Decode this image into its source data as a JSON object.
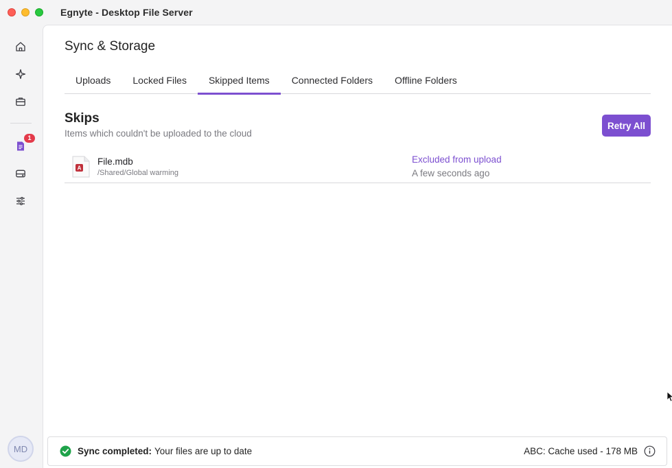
{
  "window": {
    "title": "Egnyte - Desktop File Server"
  },
  "sidebar": {
    "items": [
      {
        "name": "home",
        "icon": "home-icon"
      },
      {
        "name": "sparkle",
        "icon": "sparkle-icon"
      },
      {
        "name": "briefcase",
        "icon": "briefcase-icon"
      },
      {
        "name": "document",
        "icon": "document-icon",
        "badge": "1"
      },
      {
        "name": "drive",
        "icon": "drive-icon"
      },
      {
        "name": "settings",
        "icon": "sliders-icon"
      }
    ],
    "avatar_initials": "MD"
  },
  "page": {
    "title": "Sync & Storage",
    "tabs": [
      {
        "label": "Uploads"
      },
      {
        "label": "Locked Files"
      },
      {
        "label": "Skipped Items"
      },
      {
        "label": "Connected Folders"
      },
      {
        "label": "Offline Folders"
      }
    ],
    "active_tab": "Skipped Items"
  },
  "skips": {
    "title": "Skips",
    "subtitle": "Items which couldn't be uploaded to the cloud",
    "retry_label": "Retry All",
    "items": [
      {
        "name": "File.mdb",
        "path": "/Shared/Global warming",
        "status": "Excluded from upload",
        "time": "A few seconds ago"
      }
    ]
  },
  "statusbar": {
    "sync_label": "Sync completed:",
    "sync_text": "Your files are up to date",
    "cache_text": "ABC: Cache used - 178 MB"
  },
  "colors": {
    "accent": "#7c4fd0",
    "success": "#1fa34a",
    "badge": "#e33a4a"
  }
}
